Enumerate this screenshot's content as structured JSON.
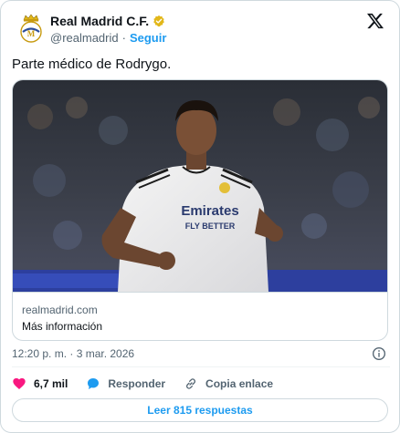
{
  "author": {
    "name": "Real Madrid C.F.",
    "handle": "@realmadrid",
    "separator": "·",
    "follow_label": "Seguir",
    "verified_color": "#e2b719"
  },
  "tweet": {
    "text": "Parte médico de Rodrygo."
  },
  "link_card": {
    "domain": "realmadrid.com",
    "more_label": "Más información"
  },
  "meta": {
    "timestamp": "12:20 p. m. · 3 mar. 2026"
  },
  "actions": {
    "likes_count": "6,7 mil",
    "reply_label": "Responder",
    "copy_link_label": "Copia enlace"
  },
  "read_replies_label": "Leer 815 respuestas",
  "colors": {
    "accent": "#1d9bf0",
    "like": "#f91880",
    "muted_text": "#536471",
    "border": "#cfd9de"
  },
  "icons": [
    "club-crest-icon",
    "verified-badge-icon",
    "x-logo-icon",
    "info-icon",
    "heart-icon",
    "reply-bubble-icon",
    "link-icon"
  ]
}
